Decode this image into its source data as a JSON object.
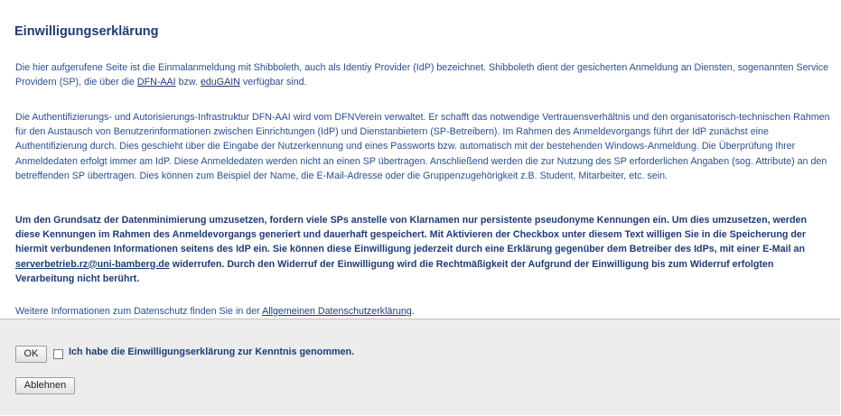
{
  "consent": {
    "title": "Einwilligungserklärung",
    "p1": {
      "a": "Die hier aufgerufene Seite ist die Einmalanmeldung mit Shibboleth, auch als Identiy Provider (IdP) bezeichnet. Shibboleth dient der gesicherten Anmeldung an Diensten, sogenannten Service Providern (SP), die über die ",
      "link1": "DFN-AAI",
      "b": " bzw. ",
      "link2": "eduGAIN",
      "c": " verfügbar sind."
    },
    "p2": "Die Authentifizierungs- und Autorisierungs-Infrastruktur DFN-AAI wird vom DFNVerein verwaltet. Er schafft das notwendige Vertrauensverhältnis und den organisatorisch-technischen Rahmen für den Austausch von Benutzerinformationen zwischen Einrichtungen (IdP) und Dienstanbietern (SP-Betreibern). Im Rahmen des Anmeldevorgangs führt der IdP zunächst eine Authentifizierung durch. Dies geschieht über die Eingabe der Nutzerkennung und eines Passworts bzw. automatisch mit der bestehenden Windows-Anmeldung. Die Überprüfung Ihrer Anmeldedaten erfolgt immer am IdP. Diese Anmeldedaten werden nicht an einen SP übertragen. Anschließend werden die zur Nutzung des SP erforderlichen Angaben (sog. Attribute) an den betreffenden SP übertragen. Dies können zum Beispiel der Name, die E-Mail-Adresse oder die Gruppenzugehörigkeit z.B. Student, Mitarbeiter, etc. sein.",
    "p3": {
      "a": "Um den Grundsatz der Datenminimierung umzusetzen, fordern viele SPs anstelle von Klarnamen nur persistente pseudonyme Kennungen ein. Um dies umzusetzen, werden diese Kennungen im Rahmen des Anmeldevorgangs generiert und dauerhaft gespeichert. Mit Aktivieren der Checkbox unter diesem Text willigen Sie in die Speicherung der hiermit verbundenen Informationen seitens des IdP ein. Sie können diese Einwilligung jederzeit durch eine Erklärung gegenüber dem Betreiber des IdPs, mit einer E-Mail an ",
      "email": "serverbetrieb.rz@uni-bamberg.de",
      "b": " widerrufen. Durch den Widerruf der Einwilligung wird die Rechtmäßigkeit der Aufgrund der Einwilligung bis zum Widerruf erfolgten Verarbeitung nicht berührt."
    },
    "p4": {
      "a": "Weitere Informationen zum Datenschutz finden Sie in der ",
      "link": "Allgemeinen Datenschutzerklärung",
      "b": "."
    }
  },
  "footer": {
    "ok_label": "OK",
    "checkbox_label": "Ich habe die Einwilligungserklärung zur Kenntnis genommen.",
    "reject_label": "Ablehnen"
  }
}
